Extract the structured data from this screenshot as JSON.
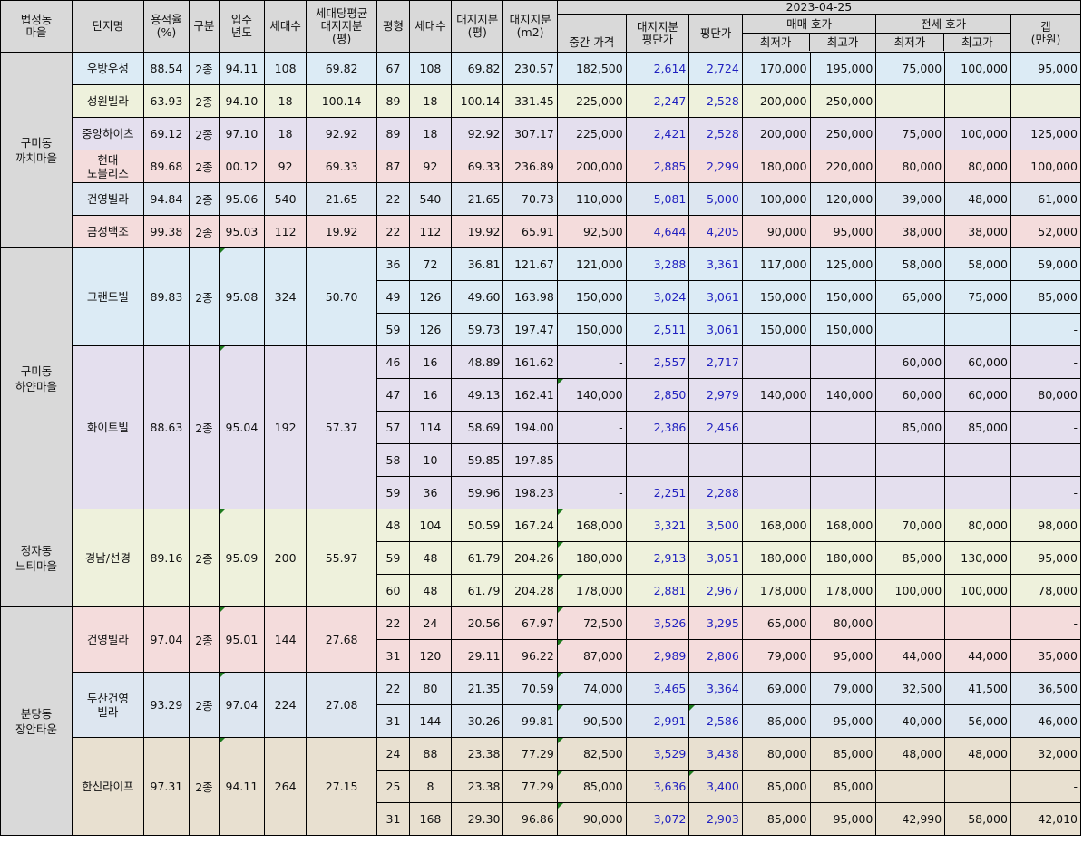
{
  "header": {
    "col_region": "법정동\n마을",
    "col_complex": "단지명",
    "col_far": "용적율\n(%)",
    "col_zone": "구분",
    "col_year": "입주\n년도",
    "col_households": "세대수",
    "col_avg_land": "세대당평균\n대지지분\n(평)",
    "col_pyeong": "평형",
    "col_households2": "세대수",
    "col_land_py": "대지지분\n(평)",
    "col_land_m2": "대지지분\n(m2)",
    "date": "2023-04-25",
    "col_mid_price": "중간 가격",
    "col_land_unit": "대지지분\n평단가",
    "col_unit": "평단가",
    "sale_group": "매매 호가",
    "jeonse_group": "전세 호가",
    "col_sale_min": "최저가",
    "col_sale_max": "최고가",
    "col_jeonse_min": "최저가",
    "col_jeonse_max": "최고가",
    "col_gap": "갭\n(만원)"
  },
  "regions": [
    {
      "name": "구미동\n까치마을",
      "complexes": [
        {
          "name": "우방우성",
          "far": "88.54",
          "zone": "2종",
          "year": "94.11",
          "hh": "108",
          "avg": "69.82",
          "bg": "bg-blue",
          "rows": [
            [
              "67",
              "108",
              "69.82",
              "230.57",
              "182,500",
              "2,614",
              "2,724",
              "170,000",
              "195,000",
              "75,000",
              "100,000",
              "95,000"
            ]
          ]
        },
        {
          "name": "성원빌라",
          "far": "63.93",
          "zone": "2종",
          "year": "94.10",
          "hh": "18",
          "avg": "100.14",
          "bg": "bg-yel",
          "rows": [
            [
              "89",
              "18",
              "100.14",
              "331.45",
              "225,000",
              "2,247",
              "2,528",
              "200,000",
              "250,000",
              "",
              "",
              "-"
            ]
          ]
        },
        {
          "name": "중앙하이츠",
          "far": "69.12",
          "zone": "2종",
          "year": "97.10",
          "hh": "18",
          "avg": "92.92",
          "bg": "bg-pur",
          "rows": [
            [
              "89",
              "18",
              "92.92",
              "307.17",
              "225,000",
              "2,421",
              "2,528",
              "200,000",
              "250,000",
              "75,000",
              "100,000",
              "125,000"
            ]
          ]
        },
        {
          "name": "현대\n노블리스",
          "far": "89.68",
          "zone": "2종",
          "year": "00.12",
          "hh": "92",
          "avg": "69.33",
          "bg": "bg-pink",
          "rows": [
            [
              "87",
              "92",
              "69.33",
              "236.89",
              "200,000",
              "2,885",
              "2,299",
              "180,000",
              "220,000",
              "80,000",
              "80,000",
              "100,000"
            ]
          ]
        },
        {
          "name": "건영빌라",
          "far": "94.84",
          "zone": "2종",
          "year": "95.06",
          "hh": "540",
          "avg": "21.65",
          "bg": "bg-blue2",
          "rows": [
            [
              "22",
              "540",
              "21.65",
              "70.73",
              "110,000",
              "5,081",
              "5,000",
              "100,000",
              "120,000",
              "39,000",
              "48,000",
              "61,000"
            ]
          ]
        },
        {
          "name": "금성백조",
          "far": "99.38",
          "zone": "2종",
          "year": "95.03",
          "hh": "112",
          "avg": "19.92",
          "bg": "bg-pink",
          "rows": [
            [
              "22",
              "112",
              "19.92",
              "65.91",
              "92,500",
              "4,644",
              "4,205",
              "90,000",
              "95,000",
              "38,000",
              "38,000",
              "52,000"
            ]
          ]
        }
      ]
    },
    {
      "name": "구미동\n하얀마을",
      "complexes": [
        {
          "name": "그랜드빌",
          "far": "89.83",
          "zone": "2종",
          "year": "95.08",
          "hh": "324",
          "avg": "50.70",
          "bg": "bg-blue",
          "rows": [
            [
              "36",
              "72",
              "36.81",
              "121.67",
              "121,000",
              "3,288",
              "3,361",
              "117,000",
              "125,000",
              "58,000",
              "58,000",
              "59,000"
            ],
            [
              "49",
              "126",
              "49.60",
              "163.98",
              "150,000",
              "3,024",
              "3,061",
              "150,000",
              "150,000",
              "65,000",
              "75,000",
              "85,000"
            ],
            [
              "59",
              "126",
              "59.73",
              "197.47",
              "150,000",
              "2,511",
              "3,061",
              "150,000",
              "150,000",
              "",
              "",
              "-"
            ]
          ]
        },
        {
          "name": "화이트빌",
          "far": "88.63",
          "zone": "2종",
          "year": "95.04",
          "hh": "192",
          "avg": "57.37",
          "bg": "bg-pur",
          "rows": [
            [
              "46",
              "16",
              "48.89",
              "161.62",
              "-",
              "2,557",
              "2,717",
              "",
              "",
              "60,000",
              "60,000",
              "-"
            ],
            [
              "47",
              "16",
              "49.13",
              "162.41",
              "140,000",
              "2,850",
              "2,979",
              "140,000",
              "140,000",
              "60,000",
              "60,000",
              "80,000"
            ],
            [
              "57",
              "114",
              "58.69",
              "194.00",
              "-",
              "2,386",
              "2,456",
              "",
              "",
              "85,000",
              "85,000",
              "-"
            ],
            [
              "58",
              "10",
              "59.85",
              "197.85",
              "-",
              "-",
              "-",
              "",
              "",
              "",
              "",
              "-"
            ],
            [
              "59",
              "36",
              "59.96",
              "198.23",
              "-",
              "2,251",
              "2,288",
              "",
              "",
              "",
              "",
              "-"
            ]
          ]
        }
      ]
    },
    {
      "name": "정자동\n느티마을",
      "complexes": [
        {
          "name": "경남/선경",
          "far": "89.16",
          "zone": "2종",
          "year": "95.09",
          "hh": "200",
          "avg": "55.97",
          "bg": "bg-yel",
          "rows": [
            [
              "48",
              "104",
              "50.59",
              "167.24",
              "168,000",
              "3,321",
              "3,500",
              "168,000",
              "168,000",
              "70,000",
              "80,000",
              "98,000"
            ],
            [
              "59",
              "48",
              "61.79",
              "204.26",
              "180,000",
              "2,913",
              "3,051",
              "180,000",
              "180,000",
              "85,000",
              "130,000",
              "95,000"
            ],
            [
              "60",
              "48",
              "61.79",
              "204.28",
              "178,000",
              "2,881",
              "2,967",
              "178,000",
              "178,000",
              "100,000",
              "100,000",
              "78,000"
            ]
          ]
        }
      ]
    },
    {
      "name": "분당동\n장안타운",
      "complexes": [
        {
          "name": "건영빌라",
          "far": "97.04",
          "zone": "2종",
          "year": "95.01",
          "hh": "144",
          "avg": "27.68",
          "bg": "bg-pink",
          "rows": [
            [
              "22",
              "24",
              "20.56",
              "67.97",
              "72,500",
              "3,526",
              "3,295",
              "65,000",
              "80,000",
              "",
              "",
              "-"
            ],
            [
              "31",
              "120",
              "29.11",
              "96.22",
              "87,000",
              "2,989",
              "2,806",
              "79,000",
              "95,000",
              "44,000",
              "44,000",
              "35,000"
            ]
          ]
        },
        {
          "name": "두산건영\n빌라",
          "far": "93.29",
          "zone": "2종",
          "year": "97.04",
          "hh": "224",
          "avg": "27.08",
          "bg": "bg-blue2",
          "rows": [
            [
              "22",
              "80",
              "21.35",
              "70.59",
              "74,000",
              "3,465",
              "3,364",
              "69,000",
              "79,000",
              "32,500",
              "41,500",
              "36,500"
            ],
            [
              "31",
              "144",
              "30.26",
              "99.81",
              "90,500",
              "2,991",
              "2,586",
              "86,000",
              "95,000",
              "40,000",
              "56,000",
              "46,000"
            ]
          ]
        },
        {
          "name": "한신라이프",
          "far": "97.31",
          "zone": "2종",
          "year": "94.11",
          "hh": "264",
          "avg": "27.15",
          "bg": "bg-tan",
          "rows": [
            [
              "24",
              "88",
              "23.38",
              "77.29",
              "82,500",
              "3,529",
              "3,438",
              "80,000",
              "85,000",
              "48,000",
              "48,000",
              "32,000"
            ],
            [
              "25",
              "8",
              "23.38",
              "77.29",
              "85,000",
              "3,636",
              "3,400",
              "85,000",
              "85,000",
              "",
              "",
              "-"
            ],
            [
              "31",
              "168",
              "29.30",
              "96.86",
              "90,000",
              "3,072",
              "2,903",
              "85,000",
              "95,000",
              "42,990",
              "58,000",
              "42,010"
            ]
          ]
        }
      ]
    }
  ]
}
